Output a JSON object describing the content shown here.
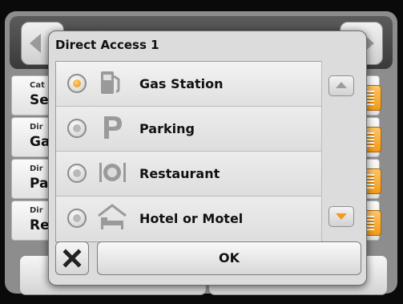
{
  "background": {
    "rows": [
      {
        "small": "Cat",
        "big": "Se"
      },
      {
        "small": "Dir",
        "big": "Ga"
      },
      {
        "small": "Dir",
        "big": "Pa"
      },
      {
        "small": "Dir",
        "big": "Re"
      }
    ]
  },
  "dialog": {
    "title": "Direct Access 1",
    "options": [
      {
        "label": "Gas Station",
        "icon": "fuel-pump-icon",
        "selected": true
      },
      {
        "label": "Parking",
        "icon": "parking-icon",
        "selected": false
      },
      {
        "label": "Restaurant",
        "icon": "restaurant-icon",
        "selected": false
      },
      {
        "label": "Hotel or Motel",
        "icon": "hotel-bed-icon",
        "selected": false
      }
    ],
    "ok_label": "OK",
    "close_icon": "close-icon"
  },
  "colors": {
    "accent": "#f39b18",
    "dialog_bg": "#dcdcdc"
  }
}
